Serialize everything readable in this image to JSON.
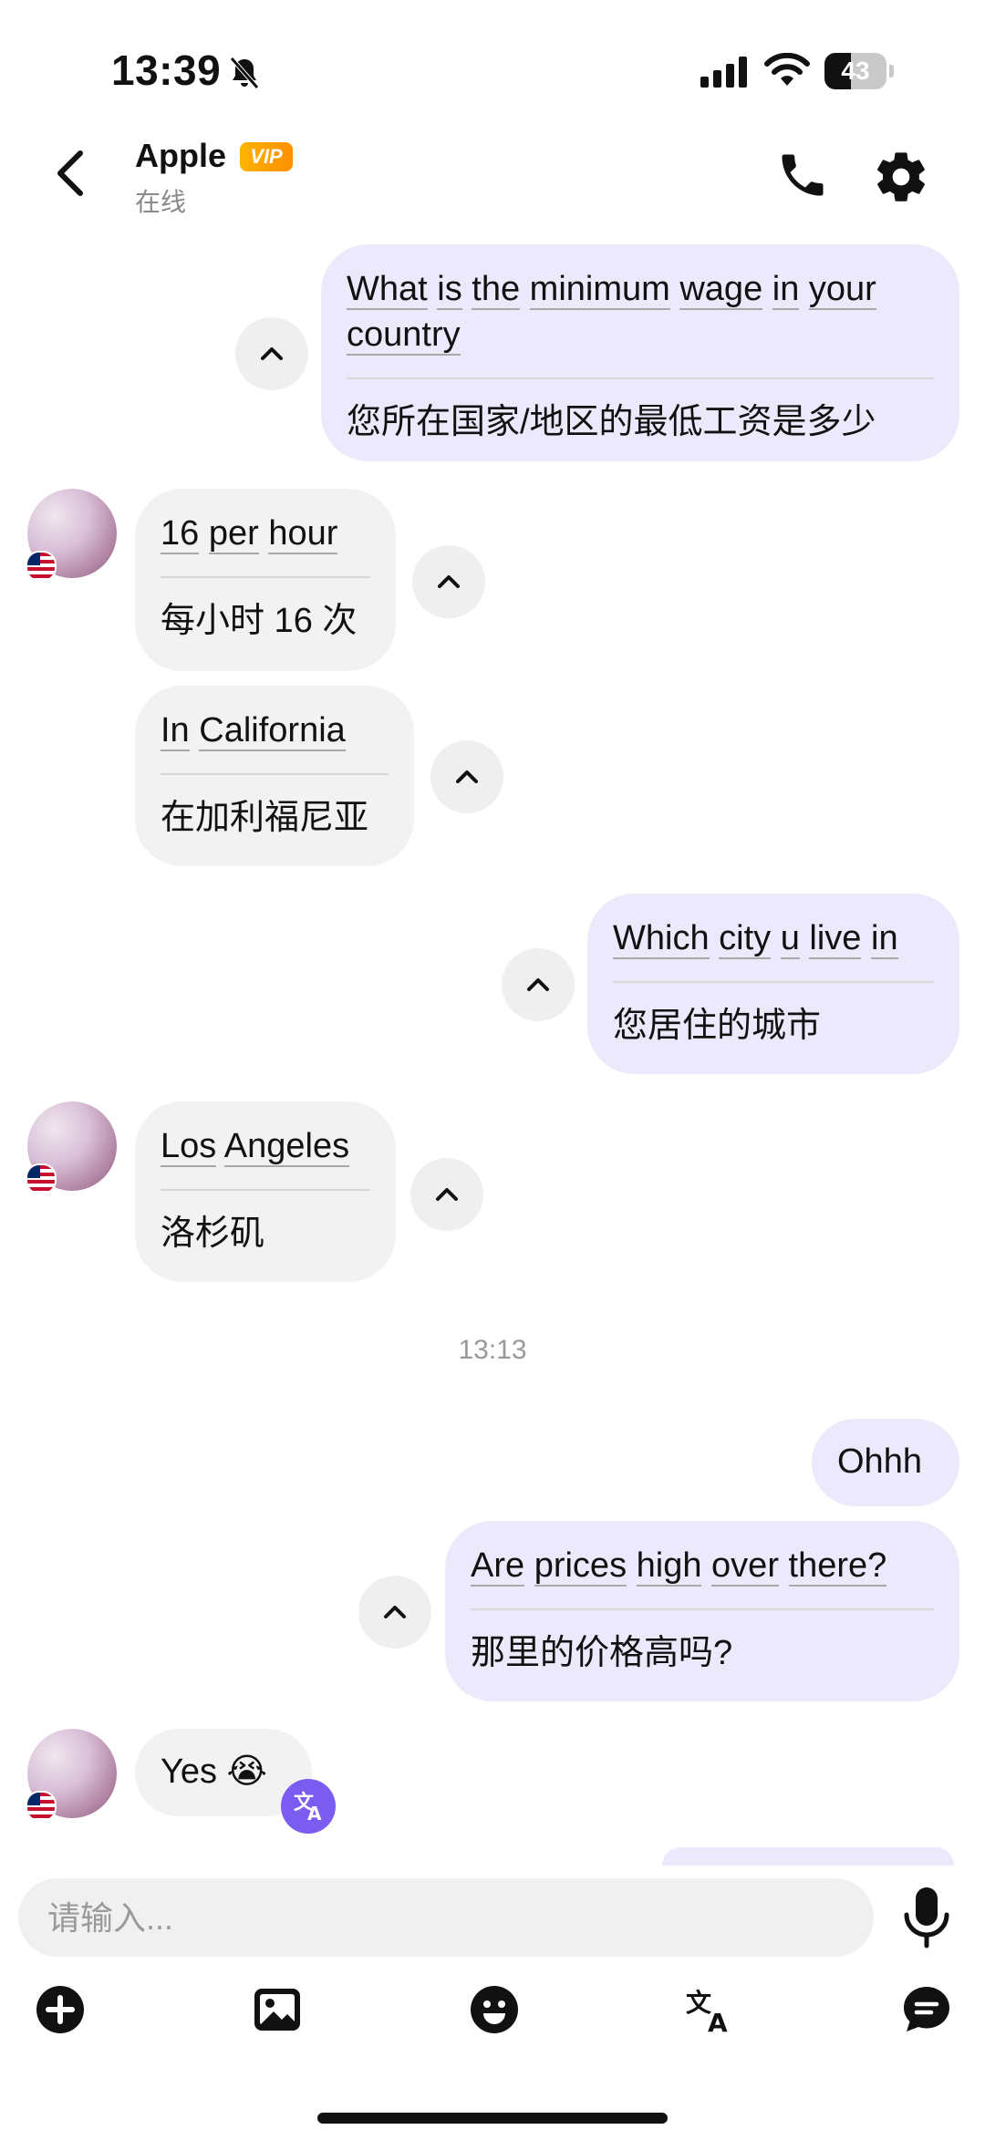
{
  "status_bar": {
    "time": "13:39",
    "battery_level": 43,
    "battery_text": "43"
  },
  "header": {
    "contact_name": "Apple",
    "vip_label": "VIP",
    "status": "在线"
  },
  "messages": [
    {
      "direction": "out",
      "original_words": [
        "What",
        "is",
        "the",
        "minimum",
        "wage",
        "in",
        "your",
        "country"
      ],
      "translation": "您所在国家/地区的最低工资是多少"
    },
    {
      "direction": "in",
      "original_words": [
        "16",
        "per",
        "hour"
      ],
      "translation": "每小时 16 次"
    },
    {
      "direction": "in",
      "original_words": [
        "In",
        "California"
      ],
      "translation": "在加利福尼亚"
    },
    {
      "direction": "out",
      "original_words": [
        "Which",
        "city",
        "u",
        "live",
        "in"
      ],
      "translation": "您居住的城市"
    },
    {
      "direction": "in",
      "original_words": [
        "Los",
        "Angeles"
      ],
      "translation": "洛杉矶"
    },
    {
      "direction": "out",
      "text": "Ohhh"
    },
    {
      "direction": "out",
      "original_words": [
        "Are",
        "prices",
        "high",
        "over",
        "there?"
      ],
      "translation": "那里的价格高吗?"
    },
    {
      "direction": "in",
      "text": "Yes 😭"
    }
  ],
  "timestamp": "13:13",
  "composer": {
    "placeholder": "请输入..."
  },
  "icons": {
    "back": "chevron-left-icon",
    "phone": "phone-icon",
    "settings": "gear-icon",
    "collapse": "chevron-up-icon",
    "translate": "translate-icon",
    "mic": "microphone-icon",
    "add": "plus-circle-icon",
    "image": "image-icon",
    "emoji": "emoji-icon",
    "chat": "chat-bubble-icon"
  },
  "colors": {
    "outgoing_bubble": "#ece9fd",
    "incoming_bubble": "#f2f2f2",
    "accent": "#7b5cf0",
    "vip": "#ffa000"
  }
}
